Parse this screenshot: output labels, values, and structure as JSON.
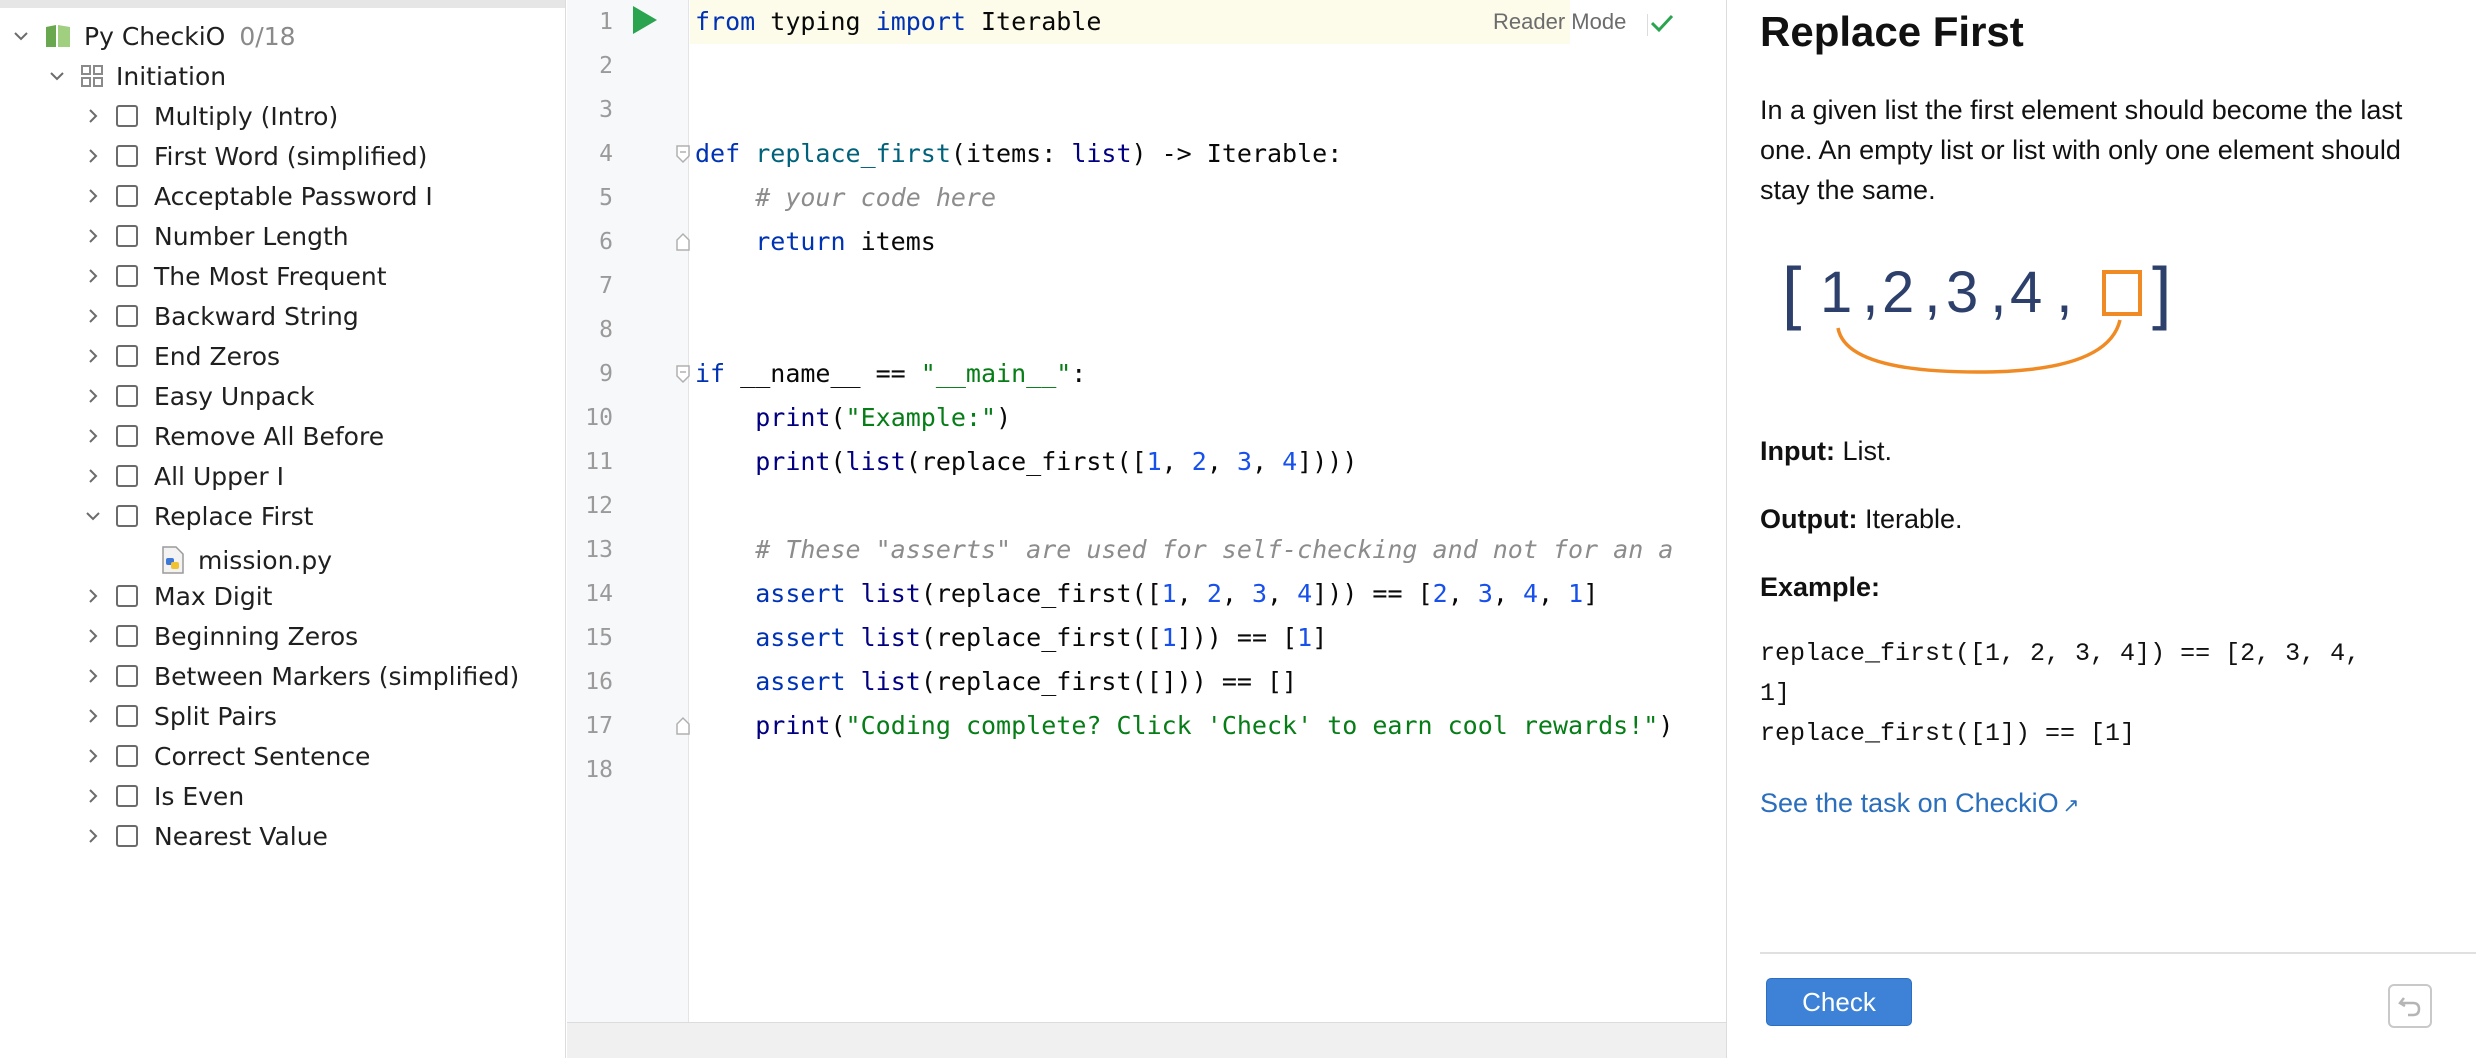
{
  "tree": {
    "root": {
      "label": "Py CheckiO",
      "progress": "0/18"
    },
    "section": {
      "label": "Initiation"
    },
    "tasks": [
      {
        "label": "Multiply (Intro)",
        "expanded": false
      },
      {
        "label": "First Word (simplified)",
        "expanded": false
      },
      {
        "label": "Acceptable Password I",
        "expanded": false
      },
      {
        "label": "Number Length",
        "expanded": false
      },
      {
        "label": "The Most Frequent",
        "expanded": false
      },
      {
        "label": "Backward String",
        "expanded": false
      },
      {
        "label": "End Zeros",
        "expanded": false
      },
      {
        "label": "Easy Unpack",
        "expanded": false
      },
      {
        "label": "Remove All Before",
        "expanded": false
      },
      {
        "label": "All Upper I",
        "expanded": false
      },
      {
        "label": "Replace First",
        "expanded": true
      },
      {
        "label": "Max Digit",
        "expanded": false
      },
      {
        "label": "Beginning Zeros",
        "expanded": false
      },
      {
        "label": "Between Markers (simplified)",
        "expanded": false
      },
      {
        "label": "Split Pairs",
        "expanded": false
      },
      {
        "label": "Correct Sentence",
        "expanded": false
      },
      {
        "label": "Is Even",
        "expanded": false
      },
      {
        "label": "Nearest Value",
        "expanded": false
      }
    ],
    "file": {
      "label": "mission.py"
    }
  },
  "editor": {
    "reader_mode": "Reader Mode",
    "line_numbers": [
      "1",
      "2",
      "3",
      "4",
      "5",
      "6",
      "7",
      "8",
      "9",
      "10",
      "11",
      "12",
      "13",
      "14",
      "15",
      "16",
      "17",
      "18"
    ],
    "lines": [
      [
        {
          "t": "from",
          "c": "kw"
        },
        {
          "t": " typing "
        },
        {
          "t": "import",
          "c": "kw"
        },
        {
          "t": " Iterable"
        }
      ],
      [],
      [],
      [
        {
          "t": "def",
          "c": "kw"
        },
        {
          "t": " "
        },
        {
          "t": "replace_first",
          "c": "fn"
        },
        {
          "t": "(items: "
        },
        {
          "t": "list",
          "c": "bi"
        },
        {
          "t": ") -> Iterable:"
        }
      ],
      [
        {
          "t": "    "
        },
        {
          "t": "# your code here",
          "c": "cm"
        }
      ],
      [
        {
          "t": "    "
        },
        {
          "t": "return",
          "c": "kw"
        },
        {
          "t": " items"
        }
      ],
      [],
      [],
      [
        {
          "t": "if",
          "c": "kw"
        },
        {
          "t": " __name__ == "
        },
        {
          "t": "\"__main__\"",
          "c": "str"
        },
        {
          "t": ":"
        }
      ],
      [
        {
          "t": "    "
        },
        {
          "t": "print",
          "c": "bi"
        },
        {
          "t": "("
        },
        {
          "t": "\"Example:\"",
          "c": "str"
        },
        {
          "t": ")"
        }
      ],
      [
        {
          "t": "    "
        },
        {
          "t": "print",
          "c": "bi"
        },
        {
          "t": "("
        },
        {
          "t": "list",
          "c": "bi"
        },
        {
          "t": "(replace_first(["
        },
        {
          "t": "1",
          "c": "num"
        },
        {
          "t": ", "
        },
        {
          "t": "2",
          "c": "num"
        },
        {
          "t": ", "
        },
        {
          "t": "3",
          "c": "num"
        },
        {
          "t": ", "
        },
        {
          "t": "4",
          "c": "num"
        },
        {
          "t": "])))"
        }
      ],
      [],
      [
        {
          "t": "    "
        },
        {
          "t": "# These \"asserts\" are used for self-checking and not for an a",
          "c": "cm"
        }
      ],
      [
        {
          "t": "    "
        },
        {
          "t": "assert",
          "c": "kw"
        },
        {
          "t": " "
        },
        {
          "t": "list",
          "c": "bi"
        },
        {
          "t": "(replace_first(["
        },
        {
          "t": "1",
          "c": "num"
        },
        {
          "t": ", "
        },
        {
          "t": "2",
          "c": "num"
        },
        {
          "t": ", "
        },
        {
          "t": "3",
          "c": "num"
        },
        {
          "t": ", "
        },
        {
          "t": "4",
          "c": "num"
        },
        {
          "t": "])) == ["
        },
        {
          "t": "2",
          "c": "num"
        },
        {
          "t": ", "
        },
        {
          "t": "3",
          "c": "num"
        },
        {
          "t": ", "
        },
        {
          "t": "4",
          "c": "num"
        },
        {
          "t": ", "
        },
        {
          "t": "1",
          "c": "num"
        },
        {
          "t": "]"
        }
      ],
      [
        {
          "t": "    "
        },
        {
          "t": "assert",
          "c": "kw"
        },
        {
          "t": " "
        },
        {
          "t": "list",
          "c": "bi"
        },
        {
          "t": "(replace_first(["
        },
        {
          "t": "1",
          "c": "num"
        },
        {
          "t": "])) == ["
        },
        {
          "t": "1",
          "c": "num"
        },
        {
          "t": "]"
        }
      ],
      [
        {
          "t": "    "
        },
        {
          "t": "assert",
          "c": "kw"
        },
        {
          "t": " "
        },
        {
          "t": "list",
          "c": "bi"
        },
        {
          "t": "(replace_first([])) == []"
        }
      ],
      [
        {
          "t": "    "
        },
        {
          "t": "print",
          "c": "bi"
        },
        {
          "t": "("
        },
        {
          "t": "\"Coding complete? Click 'Check' to earn cool rewards!\"",
          "c": "str"
        },
        {
          "t": ")"
        }
      ],
      []
    ]
  },
  "task": {
    "title": "Replace First",
    "description": "In a given list the first element should become the last one. An empty list or list with only one element should stay the same.",
    "illustration": {
      "open": "[",
      "items": [
        "1",
        ",",
        "2",
        ",",
        "3",
        ",",
        "4",
        ","
      ],
      "close": "]",
      "accent": "#f08a24",
      "ink": "#2d3f6b"
    },
    "input_label": "Input:",
    "input_value": " List.",
    "output_label": "Output:",
    "output_value": " Iterable.",
    "example_label": "Example:",
    "example_lines": [
      "replace_first([1, 2, 3, 4]) == [2, 3, 4,",
      "1]",
      "replace_first([1]) == [1]"
    ],
    "link_text": "See the task on CheckiO",
    "link_arrow": "↗",
    "check_label": "Check"
  },
  "colors": {
    "accent": "#3d82d6",
    "link": "#2a6ebc",
    "run": "#2aa44f"
  }
}
